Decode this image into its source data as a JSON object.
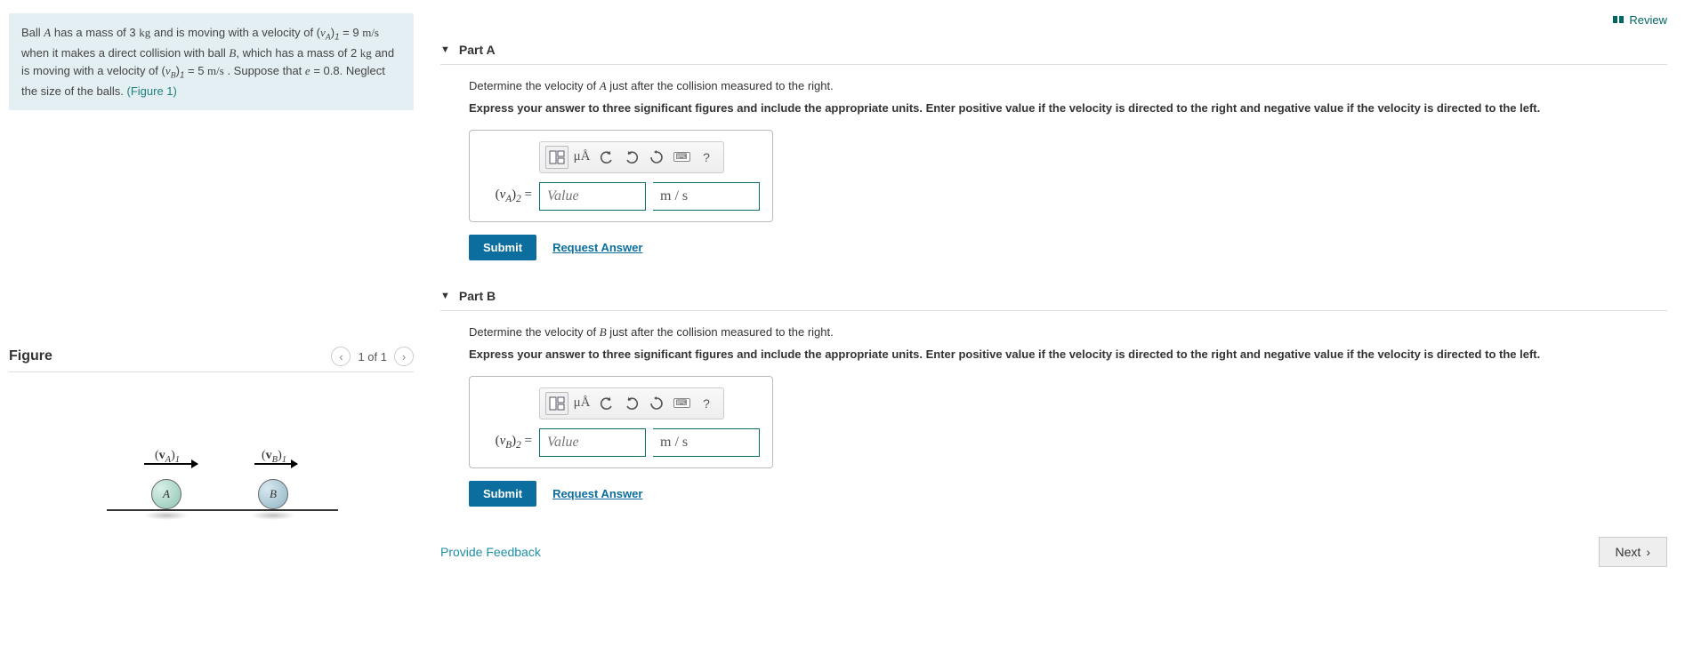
{
  "review_label": "Review",
  "problem": {
    "text_html": "Ball <span class='italic-v'>A</span> has a mass of 3 <span class='unit'>kg</span> and is moving with a velocity of (<span class='italic-v'>v<span class='sub'>A</span></span>)<span class='sub'>1</span> = 9  <span class='unit'>m/s</span> when it makes a direct collision with ball <span class='italic-v'>B</span>, which has a mass of 2  <span class='unit'>kg</span> and is moving with a velocity of (<span class='italic-v'>v<span class='sub'>B</span></span>)<span class='sub'>1</span> = 5  <span class='unit'>m/s</span> . Suppose that <span class='italic-v'>e</span> = 0.8. Neglect the size of the balls. ",
    "figure_link": "(Figure 1)"
  },
  "figure": {
    "title": "Figure",
    "page": "1 of 1",
    "ball_a_label": "A",
    "ball_b_label": "B",
    "vel_a_label_html": "(<b>v</b><span class='sub'>A</span>)<span class='sub'>1</span>",
    "vel_b_label_html": "(<b>v</b><span class='sub'>B</span>)<span class='sub'>1</span>"
  },
  "partA": {
    "title": "Part A",
    "question_html": "Determine the velocity of <span class='italic-v'>A</span> just after the collision measured to the right.",
    "instruction": "Express your answer to three significant figures and include the appropriate units. Enter positive value if the velocity is directed to the right and negative value if the velocity is directed to the left.",
    "var_label_html": "(<span class='italic-v'>v<span class='sub'>A</span></span>)<span class='sub'>2</span> =",
    "value_placeholder": "Value",
    "units_placeholder": "m / s",
    "submit": "Submit",
    "request": "Request Answer"
  },
  "partB": {
    "title": "Part B",
    "question_html": "Determine the velocity of <span class='italic-v'>B</span> just after the collision measured to the right.",
    "instruction": "Express your answer to three significant figures and include the appropriate units. Enter positive value if the velocity is directed to the right and negative value if the velocity is directed to the left.",
    "var_label_html": "(<span class='italic-v'>v<span class='sub'>B</span></span>)<span class='sub'>2</span> =",
    "value_placeholder": "Value",
    "units_placeholder": "m / s",
    "submit": "Submit",
    "request": "Request Answer"
  },
  "toolbar": {
    "mua_label": "μÅ",
    "help": "?"
  },
  "feedback_label": "Provide Feedback",
  "next_label": "Next"
}
